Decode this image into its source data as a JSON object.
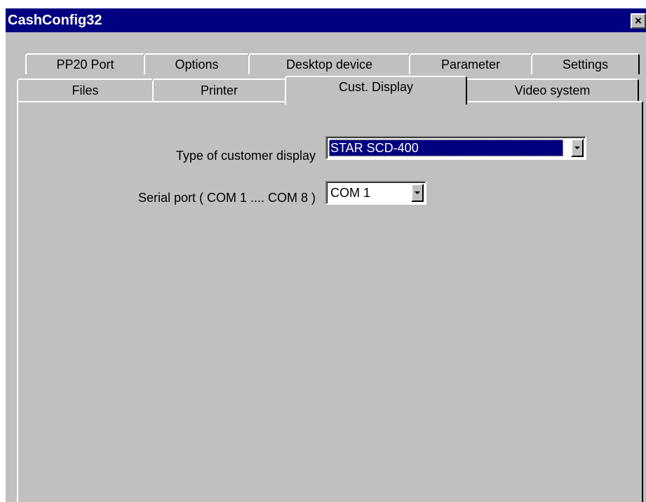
{
  "window": {
    "title": "CashConfig32",
    "close_glyph": "×"
  },
  "tabs": {
    "row1": [
      "PP20 Port",
      "Options",
      "Desktop device",
      "Parameter",
      "Settings"
    ],
    "row2": [
      "Files",
      "Printer",
      "Cust. Display",
      "Video system"
    ],
    "active": "Cust. Display"
  },
  "form": {
    "display_type": {
      "label": "Type of customer display",
      "value": "STAR SCD-400"
    },
    "serial_port": {
      "label": "Serial port ( COM 1 .... COM 8 )",
      "value": "COM 1"
    }
  },
  "colors": {
    "titlebar": "#000080",
    "face": "#c0c0c0",
    "selection": "#000080"
  },
  "icons": {
    "close": "close-icon",
    "dropdown": "chevron-down-icon"
  }
}
